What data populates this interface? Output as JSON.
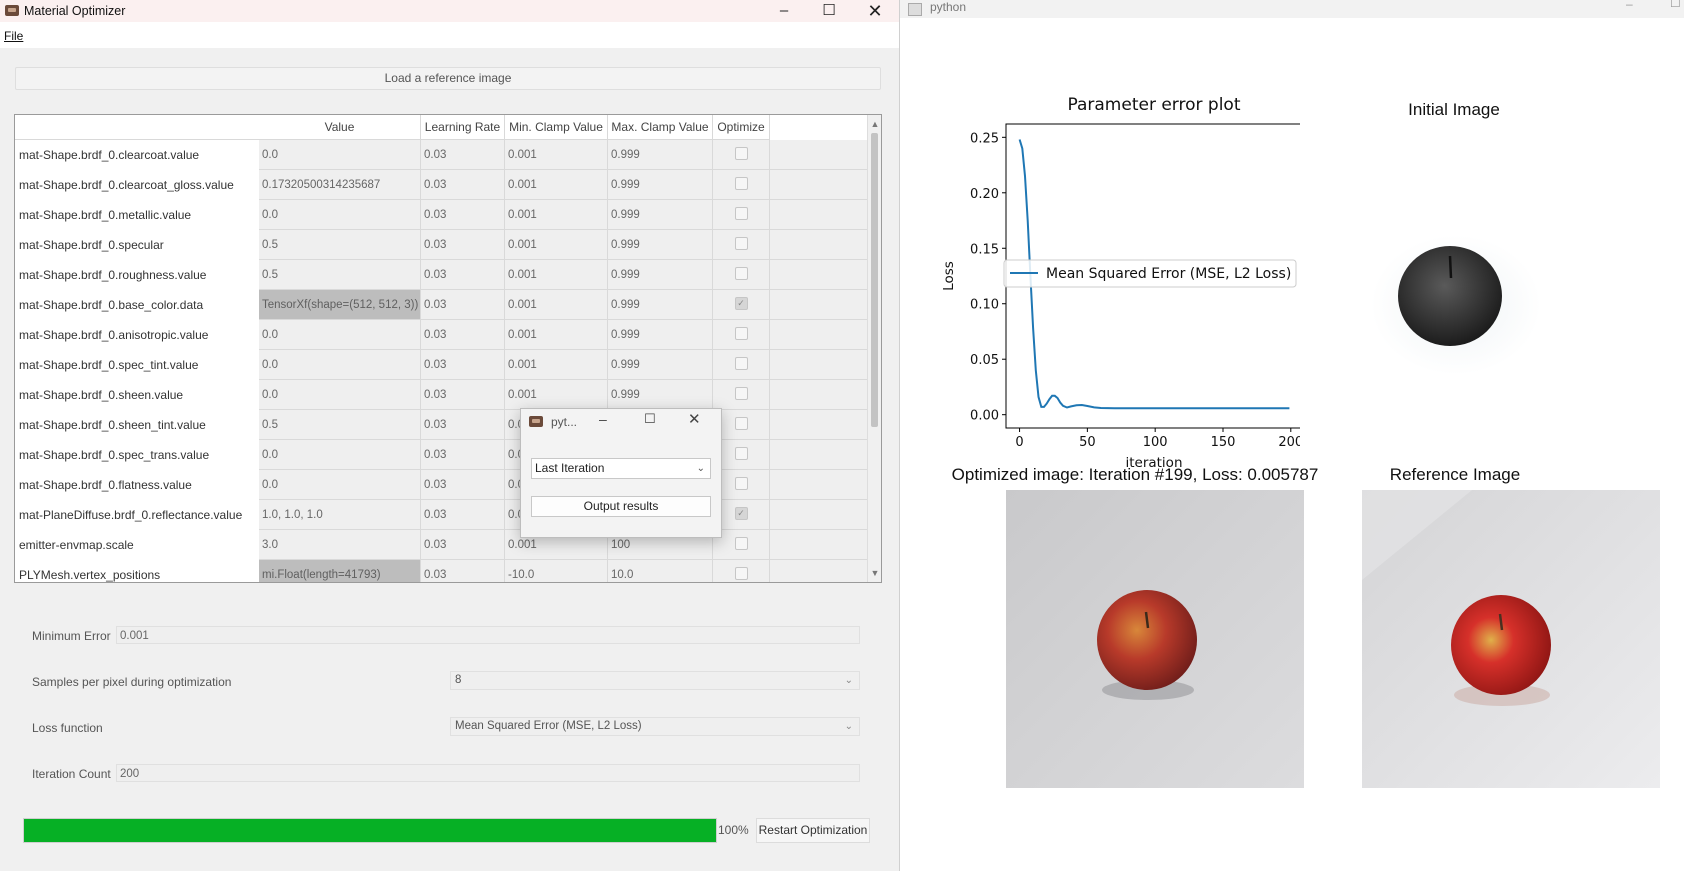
{
  "left_window": {
    "title": "Material Optimizer",
    "menu": {
      "file": "File"
    },
    "load_button": "Load a reference image",
    "table": {
      "headers": [
        "Value",
        "Learning Rate",
        "Min. Clamp Value",
        "Max. Clamp Value",
        "Optimize"
      ],
      "rows": [
        {
          "name": "mat-Shape.brdf_0.clearcoat.value",
          "value": "0.0",
          "lr": "0.03",
          "min": "0.001",
          "max": "0.999",
          "opt": false,
          "grey": false
        },
        {
          "name": "mat-Shape.brdf_0.clearcoat_gloss.value",
          "value": "0.17320500314235687",
          "lr": "0.03",
          "min": "0.001",
          "max": "0.999",
          "opt": false,
          "grey": false
        },
        {
          "name": "mat-Shape.brdf_0.metallic.value",
          "value": "0.0",
          "lr": "0.03",
          "min": "0.001",
          "max": "0.999",
          "opt": false,
          "grey": false
        },
        {
          "name": "mat-Shape.brdf_0.specular",
          "value": "0.5",
          "lr": "0.03",
          "min": "0.001",
          "max": "0.999",
          "opt": false,
          "grey": false
        },
        {
          "name": "mat-Shape.brdf_0.roughness.value",
          "value": "0.5",
          "lr": "0.03",
          "min": "0.001",
          "max": "0.999",
          "opt": false,
          "grey": false
        },
        {
          "name": "mat-Shape.brdf_0.base_color.data",
          "value": "TensorXf(shape=(512, 512, 3))",
          "lr": "0.03",
          "min": "0.001",
          "max": "0.999",
          "opt": true,
          "grey": true
        },
        {
          "name": "mat-Shape.brdf_0.anisotropic.value",
          "value": "0.0",
          "lr": "0.03",
          "min": "0.001",
          "max": "0.999",
          "opt": false,
          "grey": false
        },
        {
          "name": "mat-Shape.brdf_0.spec_tint.value",
          "value": "0.0",
          "lr": "0.03",
          "min": "0.001",
          "max": "0.999",
          "opt": false,
          "grey": false
        },
        {
          "name": "mat-Shape.brdf_0.sheen.value",
          "value": "0.0",
          "lr": "0.03",
          "min": "0.001",
          "max": "0.999",
          "opt": false,
          "grey": false
        },
        {
          "name": "mat-Shape.brdf_0.sheen_tint.value",
          "value": "0.5",
          "lr": "0.03",
          "min": "0.0",
          "max": "",
          "opt": false,
          "grey": false
        },
        {
          "name": "mat-Shape.brdf_0.spec_trans.value",
          "value": "0.0",
          "lr": "0.03",
          "min": "0.0",
          "max": "",
          "opt": false,
          "grey": false
        },
        {
          "name": "mat-Shape.brdf_0.flatness.value",
          "value": "0.0",
          "lr": "0.03",
          "min": "0.0",
          "max": "",
          "opt": false,
          "grey": false
        },
        {
          "name": "mat-PlaneDiffuse.brdf_0.reflectance.value",
          "value": "1.0, 1.0, 1.0",
          "lr": "0.03",
          "min": "0.0",
          "max": "",
          "opt": true,
          "grey": false
        },
        {
          "name": "emitter-envmap.scale",
          "value": "3.0",
          "lr": "0.03",
          "min": "0.001",
          "max": "100",
          "opt": false,
          "grey": false
        },
        {
          "name": "PLYMesh.vertex_positions",
          "value": "mi.Float(length=41793)",
          "lr": "0.03",
          "min": "-10.0",
          "max": "10.0",
          "opt": false,
          "grey": true
        }
      ]
    },
    "settings": {
      "min_error_label": "Minimum Error",
      "min_error_value": "0.001",
      "spp_label": "Samples per pixel during optimization",
      "spp_value": "8",
      "loss_label": "Loss function",
      "loss_value": "Mean Squared Error (MSE, L2 Loss)",
      "iter_label": "Iteration Count",
      "iter_value": "200"
    },
    "progress": {
      "fraction": 1.0,
      "text": "100%"
    },
    "restart_button": "Restart Optimization"
  },
  "popup": {
    "title": "pyt...",
    "select_value": "Last Iteration",
    "output_button": "Output results"
  },
  "right_window": {
    "title": "python",
    "initial_title": "Initial Image",
    "optimized_title": "Optimized image: Iteration #199, Loss: 0.005787",
    "reference_title": "Reference Image"
  },
  "chart_data": {
    "type": "line",
    "title": "Parameter error plot",
    "xlabel": "iteration",
    "ylabel": "Loss",
    "xlim": [
      -10,
      209
    ],
    "ylim": [
      -0.012,
      0.262
    ],
    "xticks": [
      0,
      50,
      100,
      150,
      200
    ],
    "yticks": [
      0.0,
      0.05,
      0.1,
      0.15,
      0.2,
      0.25
    ],
    "ytick_labels": [
      "0.00",
      "0.05",
      "0.10",
      "0.15",
      "0.20",
      "0.25"
    ],
    "legend": "center-left",
    "series": [
      {
        "name": "Mean Squared Error (MSE, L2 Loss)",
        "color": "#1f77b4",
        "x": [
          0,
          2,
          4,
          6,
          8,
          10,
          12,
          14,
          16,
          18,
          20,
          22,
          24,
          26,
          28,
          30,
          32,
          35,
          38,
          42,
          46,
          50,
          55,
          60,
          70,
          80,
          100,
          120,
          150,
          180,
          199
        ],
        "y": [
          0.248,
          0.24,
          0.215,
          0.175,
          0.125,
          0.078,
          0.04,
          0.016,
          0.007,
          0.007,
          0.01,
          0.014,
          0.017,
          0.017,
          0.015,
          0.011,
          0.008,
          0.0065,
          0.0075,
          0.0085,
          0.0087,
          0.0078,
          0.0066,
          0.006,
          0.0058,
          0.0058,
          0.0058,
          0.0058,
          0.0058,
          0.0058,
          0.0058
        ]
      }
    ]
  }
}
